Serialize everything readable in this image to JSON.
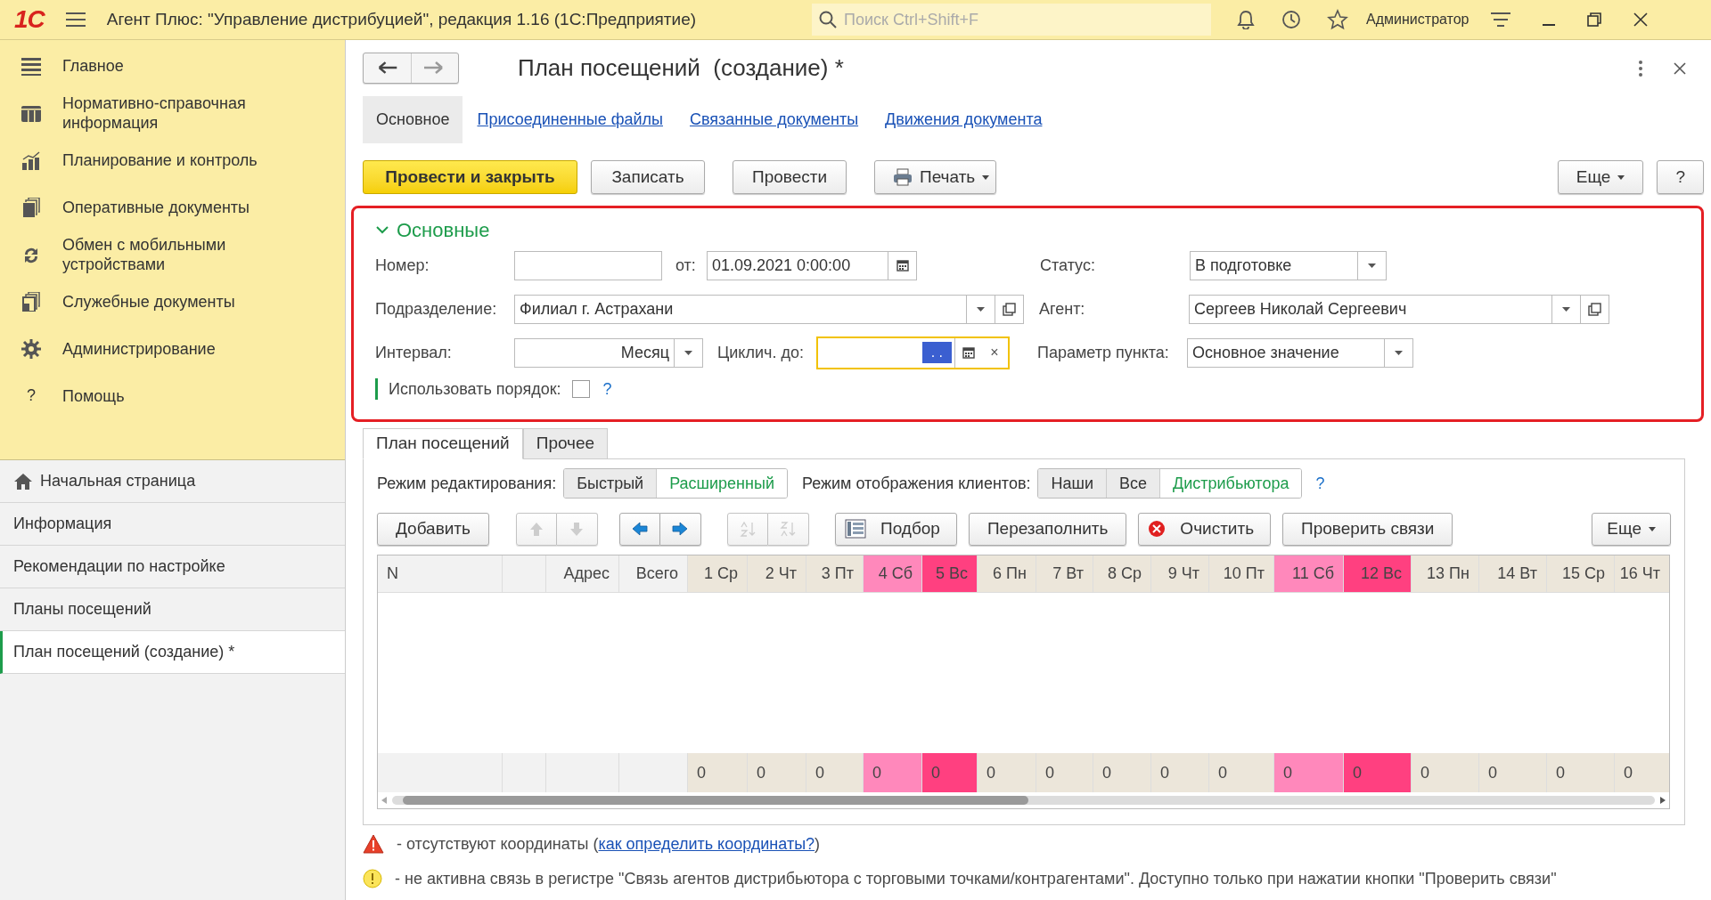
{
  "app_bar": {
    "logo": "1С",
    "title": "Агент Плюс: \"Управление дистрибуцией\", редакция 1.16  (1С:Предприятие)",
    "search": {
      "placeholder": "Поиск Ctrl+Shift+F"
    },
    "user": "Администратор"
  },
  "sidebar": {
    "sections": [
      {
        "label": "Главное"
      },
      {
        "label": "Нормативно-справочная информация"
      },
      {
        "label": "Планирование и контроль"
      },
      {
        "label": "Оперативные документы"
      },
      {
        "label": "Обмен с мобильными устройствами"
      },
      {
        "label": "Служебные документы"
      },
      {
        "label": "Администрирование"
      },
      {
        "label": "Помощь",
        "glyph": "?"
      }
    ],
    "open_windows": [
      {
        "label": "Начальная страница",
        "selected": false
      },
      {
        "label": "Информация",
        "selected": false
      },
      {
        "label": "Рекомендации по настройке",
        "selected": false
      },
      {
        "label": "Планы посещений",
        "selected": false
      },
      {
        "label": "План посещений  (создание) *",
        "selected": true
      }
    ]
  },
  "form": {
    "title": "План посещений  (создание) *",
    "tabs": [
      {
        "label": "Основное",
        "selected": true
      },
      {
        "label": "Присоединенные файлы",
        "selected": false
      },
      {
        "label": "Связанные документы",
        "selected": false
      },
      {
        "label": "Движения документа",
        "selected": false
      }
    ],
    "commands": [
      {
        "label": "Провести и закрыть",
        "kind": "primary"
      },
      {
        "label": "Записать",
        "kind": "plain"
      },
      {
        "label": "Провести",
        "kind": "plain"
      },
      {
        "label": "Печать",
        "kind": "print"
      }
    ],
    "more": "Еще",
    "help": "?",
    "group": {
      "title": "Основные",
      "expanded": true,
      "number": {
        "label": "Номер:"
      },
      "date": {
        "label": "от:",
        "value": "01.09.2021  0:00:00"
      },
      "status": {
        "label": "Статус:",
        "value": "В подготовке"
      },
      "division": {
        "label": "Подразделение:",
        "value": "Филиал г. Астрахани"
      },
      "agent": {
        "label": "Агент:",
        "value": "Сергеев Николай Сергеевич"
      },
      "interval": {
        "label": "Интервал:",
        "value": "Месяц"
      },
      "cyclic_until": {
        "label": "Циклич. до:",
        "value": ".  .",
        "focused": true,
        "clear": "×"
      },
      "point_param": {
        "label": "Параметр пункта:",
        "value": "Основное значение"
      },
      "use_order": {
        "label": "Использовать порядок:",
        "checked": false,
        "help": "?"
      }
    },
    "inner_tabs": [
      {
        "label": "План посещений",
        "selected": true
      },
      {
        "label": "Прочее",
        "selected": false
      }
    ],
    "edit_mode": {
      "label": "Режим редактирования:",
      "options": [
        {
          "label": "Быстрый",
          "selected": false
        },
        {
          "label": "Расширенный",
          "selected": true
        }
      ]
    },
    "display_mode": {
      "label": "Режим отображения клиентов:",
      "options": [
        {
          "label": "Наши",
          "selected": false
        },
        {
          "label": "Все",
          "selected": false
        },
        {
          "label": "Дистрибьютора",
          "selected": true
        }
      ],
      "help": "?"
    },
    "toolbar": [
      {
        "kind": "text",
        "label": "Добавить"
      },
      {
        "kind": "move_rows",
        "disabled": true
      },
      {
        "kind": "move_columns",
        "disabled": false
      },
      {
        "kind": "sort",
        "disabled": true
      },
      {
        "kind": "picker",
        "label": "Подбор"
      },
      {
        "kind": "text",
        "label": "Перезаполнить"
      },
      {
        "kind": "clear",
        "label": "Очистить"
      },
      {
        "kind": "text",
        "label": "Проверить связи"
      },
      {
        "kind": "menu",
        "label": "Еще"
      }
    ],
    "table": {
      "columns": [
        {
          "label": "N",
          "kind": "plain"
        },
        {
          "kind": "plain"
        },
        {
          "label": "Адрес",
          "kind": "plain"
        },
        {
          "label": "Всего",
          "kind": "plain"
        },
        {
          "label": "1 Ср",
          "kind": "weekday",
          "total": "0"
        },
        {
          "label": "2 Чт",
          "kind": "weekday",
          "total": "0"
        },
        {
          "label": "3 Пт",
          "kind": "weekday",
          "total": "0"
        },
        {
          "label": "4 Сб",
          "kind": "saturday",
          "total": "0"
        },
        {
          "label": "5 Вс",
          "kind": "sunday",
          "total": "0"
        },
        {
          "label": "6 Пн",
          "kind": "weekday",
          "total": "0"
        },
        {
          "label": "7 Вт",
          "kind": "weekday",
          "total": "0"
        },
        {
          "label": "8 Ср",
          "kind": "weekday",
          "total": "0"
        },
        {
          "label": "9 Чт",
          "kind": "weekday",
          "total": "0"
        },
        {
          "label": "10 Пт",
          "kind": "weekday",
          "total": "0"
        },
        {
          "label": "11 Сб",
          "kind": "saturday",
          "total": "0"
        },
        {
          "label": "12 Вс",
          "kind": "sunday",
          "total": "0"
        },
        {
          "label": "13 Пн",
          "kind": "weekday",
          "total": "0"
        },
        {
          "label": "14 Вт",
          "kind": "weekday",
          "total": "0"
        },
        {
          "label": "15 Ср",
          "kind": "weekday",
          "total": "0"
        },
        {
          "label": "16 Чт",
          "kind": "weekday",
          "total": "0"
        }
      ]
    },
    "legend": [
      {
        "kind": "warning",
        "text_before": " - отсутствуют координаты (",
        "link": "как определить координаты?",
        "text_after": ")"
      },
      {
        "kind": "info",
        "text": "-  не активна связь в регистре \"Связь агентов дистрибьютора с торговыми точками/контрагентами\". Доступно только при нажатии кнопки \"Проверить связи\""
      }
    ]
  }
}
